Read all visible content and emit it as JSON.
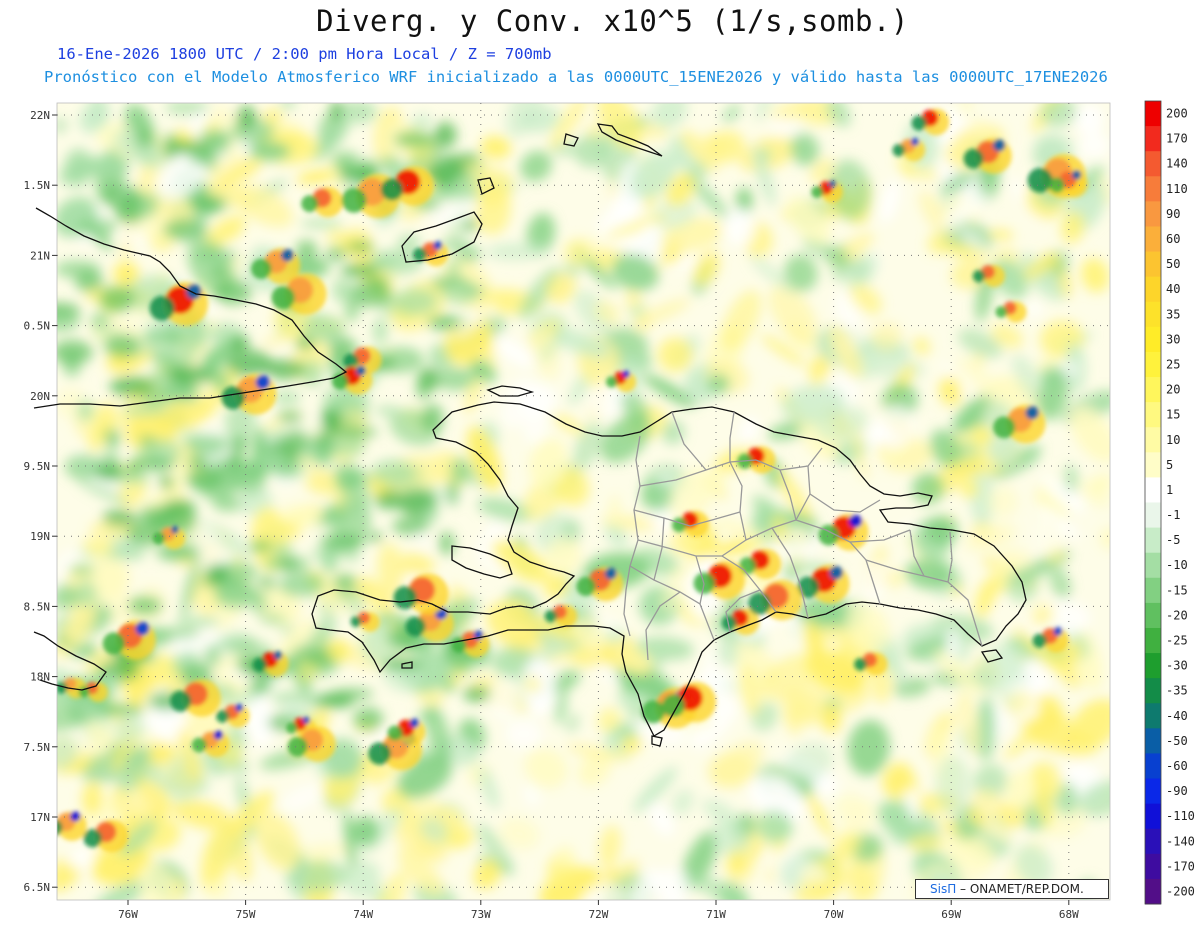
{
  "header": {
    "title": "Diverg. y Conv. x10^5 (1/s,somb.)",
    "date_line": "16-Ene-2026  1800 UTC / 2:00 pm Hora Local / Z = 700mb",
    "model_line": "Pronóstico con el Modelo Atmosferico WRF inicializado a las 0000UTC_15ENE2026 y válido hasta las  0000UTC_17ENE2026"
  },
  "map": {
    "lat_labels": [
      "22N",
      "1.5N",
      "21N",
      "0.5N",
      "20N",
      "9.5N",
      "19N",
      "8.5N",
      "18N",
      "7.5N",
      "17N",
      "6.5N"
    ],
    "lon_labels": [
      "76W",
      "75W",
      "74W",
      "73W",
      "72W",
      "71W",
      "70W",
      "69W",
      "68W"
    ],
    "lat_range": [
      16.5,
      22.0
    ],
    "lon_range": [
      -76.6,
      -67.6
    ],
    "grid": true
  },
  "colorbar": {
    "levels": [
      "200",
      "170",
      "140",
      "110",
      "90",
      "60",
      "50",
      "40",
      "35",
      "30",
      "25",
      "20",
      "15",
      "10",
      "5",
      "1",
      "-1",
      "-5",
      "-10",
      "-15",
      "-20",
      "-25",
      "-30",
      "-35",
      "-40",
      "-50",
      "-60",
      "-90",
      "-110",
      "-140",
      "-170",
      "-200"
    ],
    "colors": [
      "#ee0000",
      "#f22a1e",
      "#f45a30",
      "#f77c3a",
      "#f99840",
      "#fbaf3a",
      "#fcc430",
      "#fdd52a",
      "#fde22a",
      "#ffec28",
      "#fff23c",
      "#fff65c",
      "#fff980",
      "#fffba4",
      "#fffdc8",
      "#ffffff",
      "#eaf6ea",
      "#c8ecc8",
      "#a4dea4",
      "#82d082",
      "#60c060",
      "#40b040",
      "#1e9e2e",
      "#138c48",
      "#0e7a6e",
      "#0a5ea6",
      "#0840d0",
      "#0a28e8",
      "#1010d8",
      "#2a10b8",
      "#3e0ca0",
      "#520e88"
    ]
  },
  "credit": {
    "brand": "SisΠ",
    "text": " – ONAMET/REP.DOM."
  }
}
